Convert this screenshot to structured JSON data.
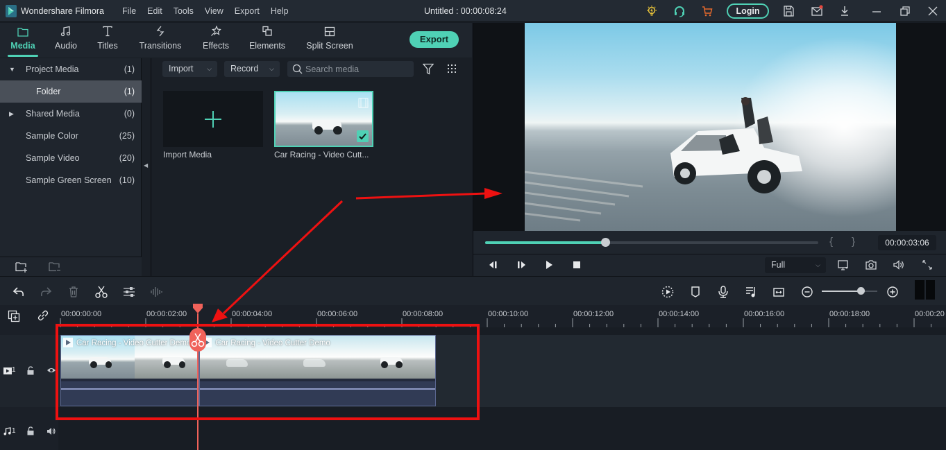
{
  "titlebar": {
    "app_name": "Wondershare Filmora",
    "menu": [
      "File",
      "Edit",
      "Tools",
      "View",
      "Export",
      "Help"
    ],
    "document_title": "Untitled : 00:00:08:24",
    "login_label": "Login",
    "icons": [
      "bulb-icon",
      "headset-icon",
      "cart-icon",
      "save-icon",
      "mail-icon",
      "download-icon",
      "minimize-icon",
      "restore-icon",
      "close-icon"
    ],
    "notification_color": "#e5483f"
  },
  "colors": {
    "accent": "#4fd1b5",
    "playhead": "#f0625a",
    "annotation": "#ee1111",
    "cart": "#e86a2c",
    "bulb": "#e6c13a"
  },
  "media_tabs": [
    {
      "label": "Media",
      "icon": "folder-icon",
      "active": true
    },
    {
      "label": "Audio",
      "icon": "music-note-icon",
      "active": false
    },
    {
      "label": "Titles",
      "icon": "text-icon",
      "active": false
    },
    {
      "label": "Transitions",
      "icon": "transition-icon",
      "active": false
    },
    {
      "label": "Effects",
      "icon": "effects-icon",
      "active": false
    },
    {
      "label": "Elements",
      "icon": "elements-icon",
      "active": false
    },
    {
      "label": "Split Screen",
      "icon": "split-screen-icon",
      "active": false
    }
  ],
  "export_label": "Export",
  "tree": [
    {
      "name": "Project Media",
      "count": "(1)",
      "caret": "down"
    },
    {
      "name": "Folder",
      "count": "(1)",
      "selected": true
    },
    {
      "name": "Shared Media",
      "count": "(0)",
      "caret": "right"
    },
    {
      "name": "Sample Color",
      "count": "(25)"
    },
    {
      "name": "Sample Video",
      "count": "(20)"
    },
    {
      "name": "Sample Green Screen",
      "count": "(10)"
    }
  ],
  "media_toolbar": {
    "import_label": "Import",
    "record_label": "Record",
    "search_placeholder": "Search media"
  },
  "media_items": [
    {
      "label": "Import Media",
      "type": "import"
    },
    {
      "label": "Car Racing - Video Cutt...",
      "type": "video",
      "selected": true
    }
  ],
  "playback": {
    "progress": 0.36,
    "brace_in": "{",
    "brace_out": "}",
    "timecode": "00:00:03:06",
    "quality": "Full"
  },
  "timeline_toolbar": {
    "left_icons": [
      "undo-icon",
      "redo-icon",
      "delete-icon",
      "scissors-icon",
      "adjust-icon",
      "audio-wave-icon"
    ],
    "right_icons": [
      "render-icon",
      "marker-icon",
      "mic-icon",
      "audio-mix-icon",
      "fit-icon",
      "zoom-out-icon",
      "zoom-in-icon"
    ],
    "zoom_level": 0.7
  },
  "ruler": {
    "labels": [
      "00:00:00:00",
      "00:00:02:00",
      "00:00:04:00",
      "00:00:06:00",
      "00:00:08:00",
      "00:00:10:00",
      "00:00:12:00",
      "00:00:14:00",
      "00:00:16:00",
      "00:00:18:00",
      "00:00:20"
    ]
  },
  "tracks": {
    "video": {
      "label": "1"
    },
    "audio": {
      "label": "1"
    }
  },
  "clips": [
    {
      "title": "Car Racing - Video Cutter Demo",
      "start_sec": 0,
      "end_sec": 3.26
    },
    {
      "title": "Car Racing - Video Cutter Demo",
      "start_sec": 3.26,
      "end_sec": 8.8
    }
  ],
  "playhead_time": "00:00:03:06"
}
